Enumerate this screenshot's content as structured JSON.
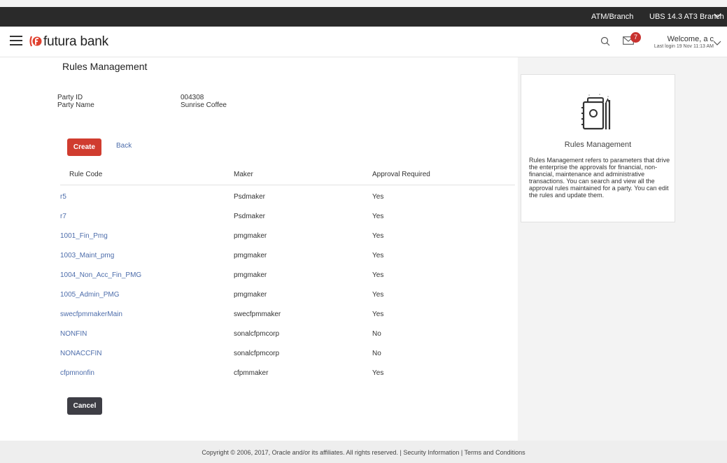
{
  "topbar": {
    "atm_branch": "ATM/Branch",
    "branch_name": "UBS 14.3 AT3 Branch"
  },
  "header": {
    "brand": "futura bank",
    "mail_badge": "7",
    "welcome": "Welcome, a c",
    "last_login": "Last login 19 Nov 11:13 AM"
  },
  "page": {
    "title": "Rules Management",
    "party_id_label": "Party ID",
    "party_id_value": "004308",
    "party_name_label": "Party Name",
    "party_name_value": "Sunrise Coffee",
    "create_label": "Create",
    "back_label": "Back",
    "cancel_label": "Cancel"
  },
  "table": {
    "headers": [
      "Rule Code",
      "Maker",
      "Approval Required"
    ],
    "rows": [
      {
        "code": "r5",
        "maker": "Psdmaker",
        "approval": "Yes"
      },
      {
        "code": "r7",
        "maker": "Psdmaker",
        "approval": "Yes"
      },
      {
        "code": "1001_Fin_Pmg",
        "maker": "pmgmaker",
        "approval": "Yes"
      },
      {
        "code": "1003_Maint_pmg",
        "maker": "pmgmaker",
        "approval": "Yes"
      },
      {
        "code": "1004_Non_Acc_Fin_PMG",
        "maker": "pmgmaker",
        "approval": "Yes"
      },
      {
        "code": "1005_Admin_PMG",
        "maker": "pmgmaker",
        "approval": "Yes"
      },
      {
        "code": "swecfpmmakerMain",
        "maker": "swecfpmmaker",
        "approval": "Yes"
      },
      {
        "code": "NONFIN",
        "maker": "sonalcfpmcorp",
        "approval": "No"
      },
      {
        "code": "NONACCFIN",
        "maker": "sonalcfpmcorp",
        "approval": "No"
      },
      {
        "code": "cfpmnonfin",
        "maker": "cfpmmaker",
        "approval": "Yes"
      }
    ]
  },
  "help": {
    "title": "Rules Management",
    "text": "Rules Management refers to parameters that drive the enterprise the approvals for financial, non-financial, maintenance and administrative transactions. You can search and view all the approval rules maintained for a party. You can edit the rules and update them."
  },
  "footer": {
    "text": "Copyright © 2006, 2017, Oracle and/or its affiliates. All rights reserved. | Security Information | Terms and Conditions"
  },
  "colors": {
    "accent": "#d03c2f",
    "link": "#4d6dab",
    "topbar": "#2a2a2a",
    "cancel": "#3e3e45"
  }
}
